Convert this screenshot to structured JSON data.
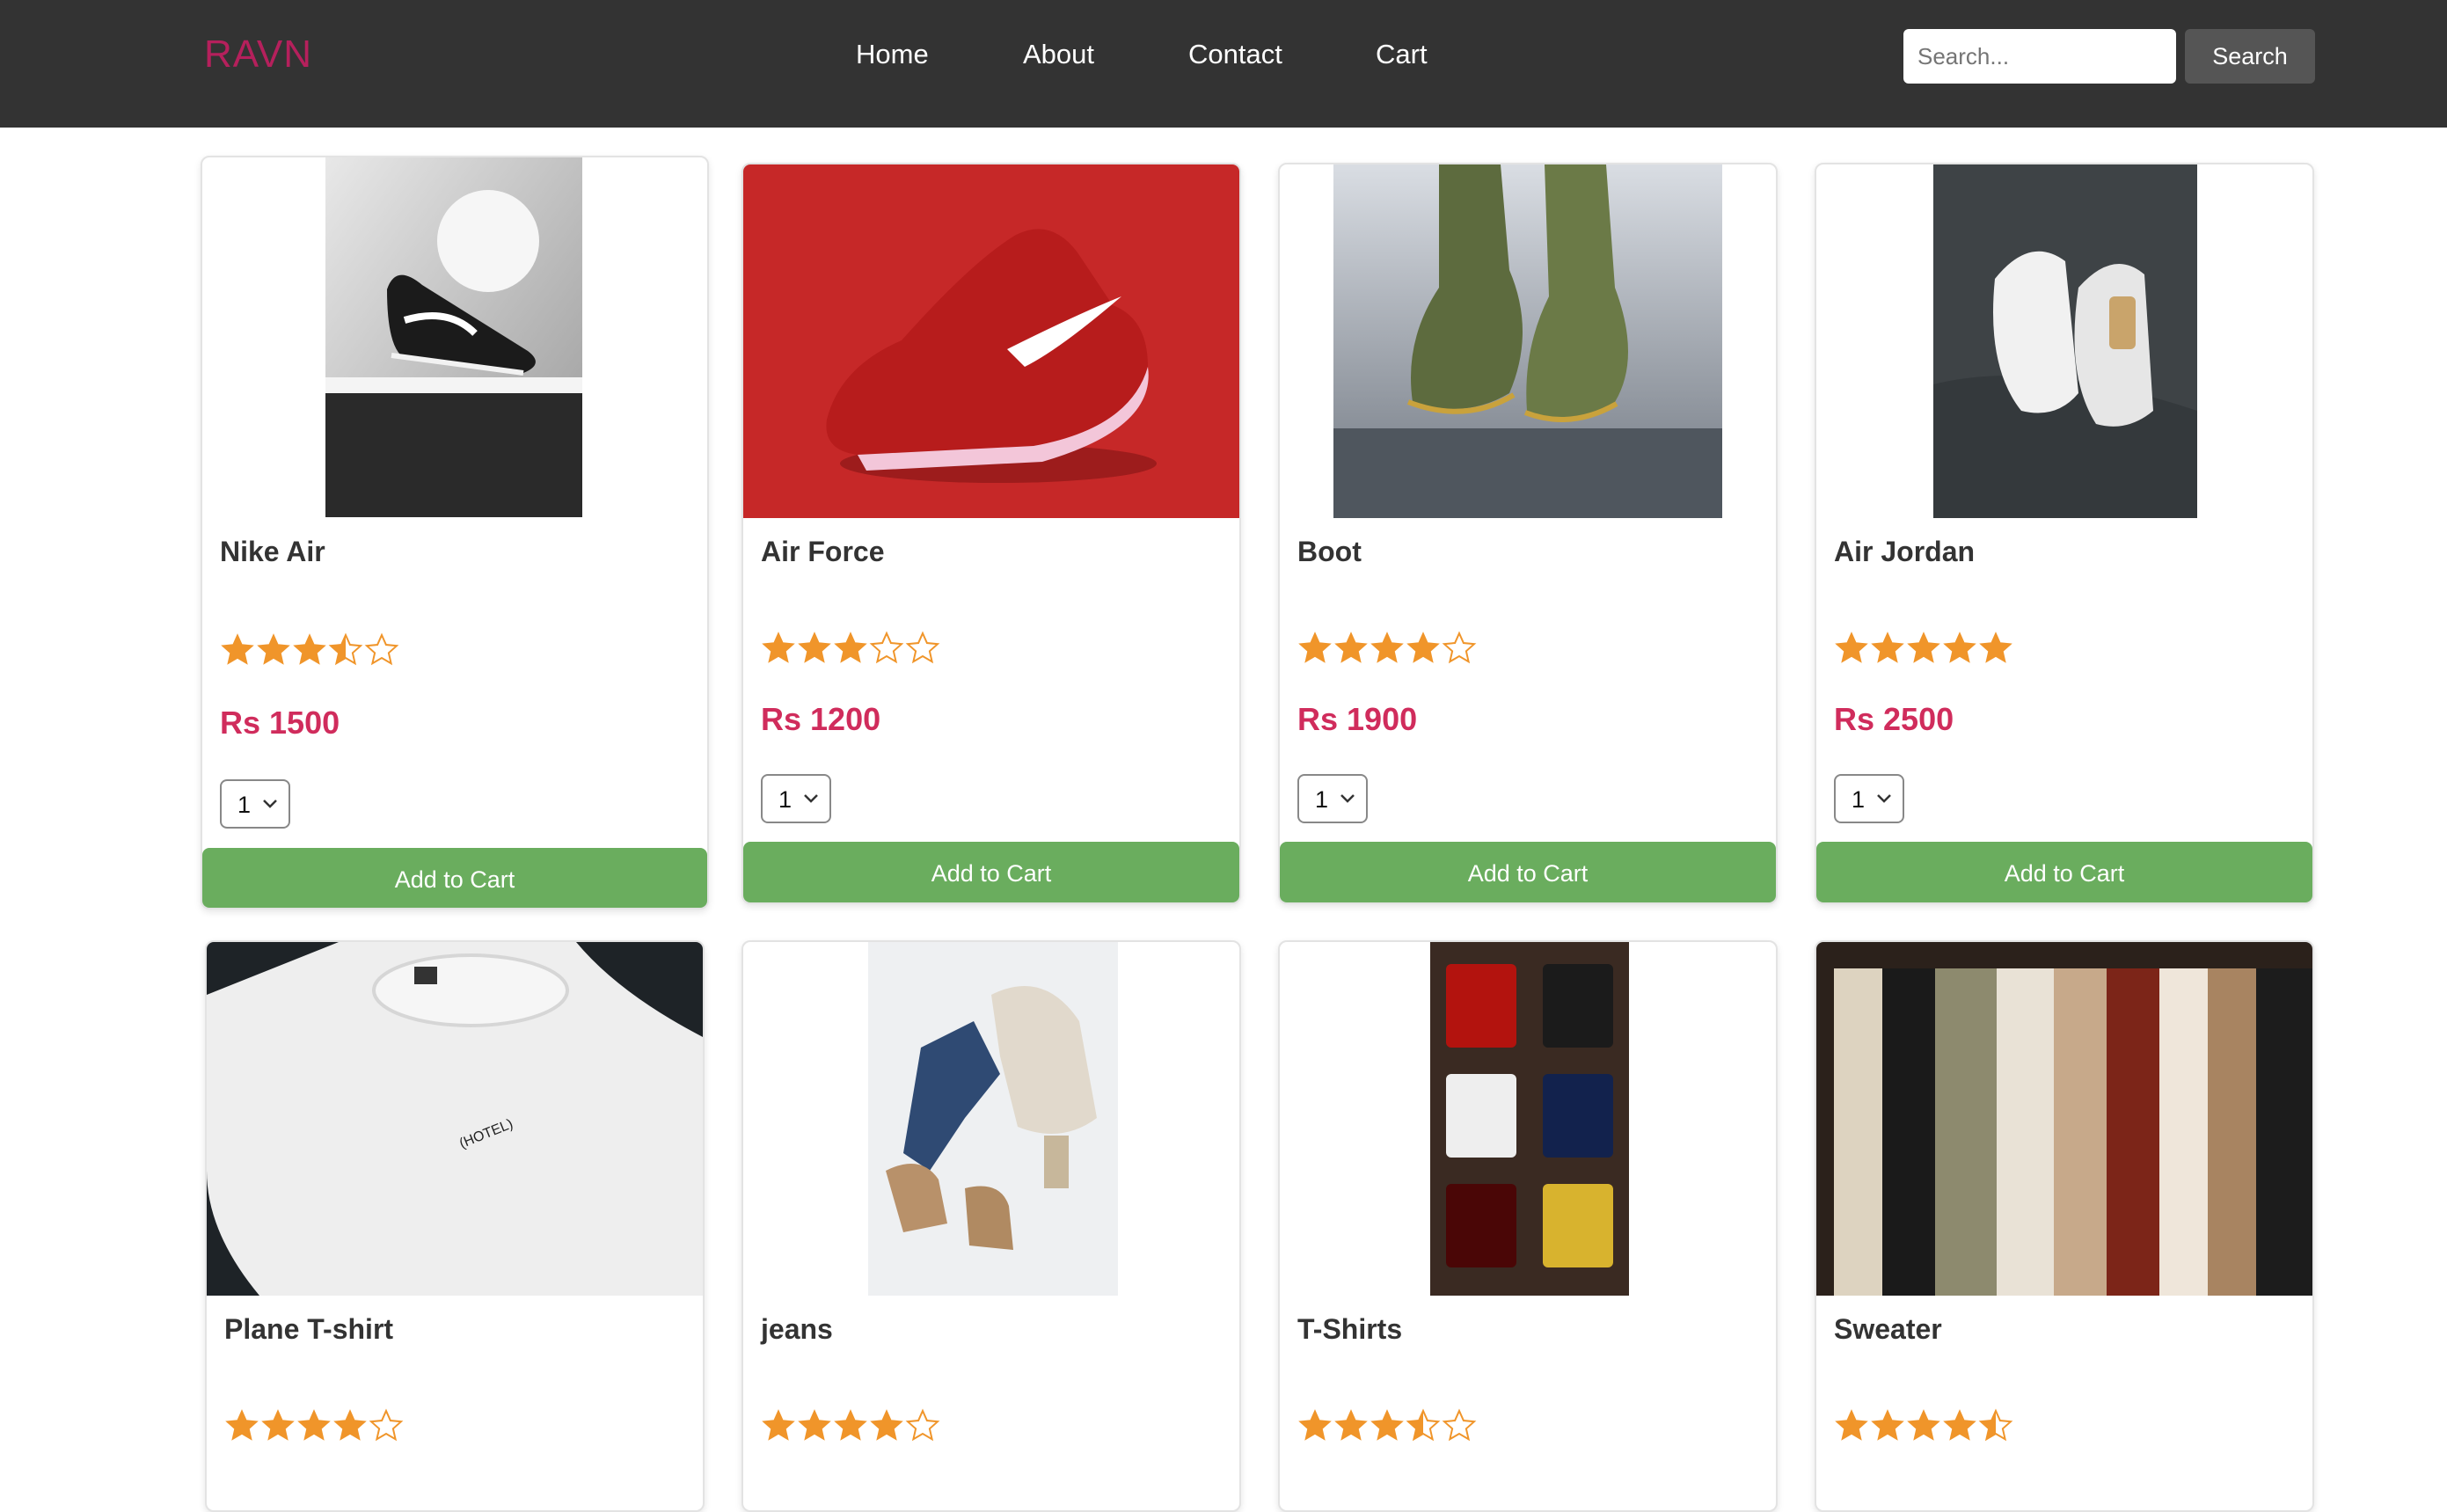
{
  "header": {
    "logo": "RAVN",
    "nav": [
      "Home",
      "About",
      "Contact",
      "Cart"
    ],
    "search_placeholder": "Search...",
    "search_button": "Search"
  },
  "colors": {
    "navbar_bg": "#333333",
    "logo": "#b5205c",
    "price": "#d02c5c",
    "star": "#f0952a",
    "add_button": "#6aad5e"
  },
  "products": [
    {
      "name": "Nike Air",
      "rating": 3.5,
      "price": "Rs 1500",
      "qty": "1",
      "button": "Add to Cart"
    },
    {
      "name": "Air Force",
      "rating": 3,
      "price": "Rs 1200",
      "qty": "1",
      "button": "Add to Cart"
    },
    {
      "name": "Boot",
      "rating": 4,
      "price": "Rs 1900",
      "qty": "1",
      "button": "Add to Cart"
    },
    {
      "name": "Air Jordan",
      "rating": 5,
      "price": "Rs 2500",
      "qty": "1",
      "button": "Add to Cart"
    },
    {
      "name": "Plane T-shirt",
      "rating": 4
    },
    {
      "name": "jeans",
      "rating": 4
    },
    {
      "name": "T-Shirts",
      "rating": 3.5
    },
    {
      "name": "Sweater",
      "rating": 4.5
    }
  ]
}
